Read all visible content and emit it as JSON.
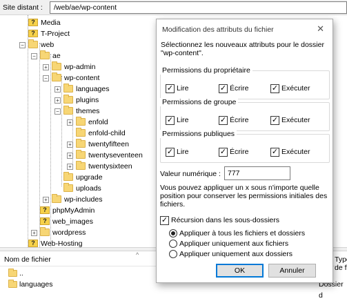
{
  "pathbar": {
    "label": "Site distant :",
    "value": "/web/ae/wp-content"
  },
  "tree": [
    {
      "label": "Media",
      "icon": "question-folder-icon",
      "expander": ""
    },
    {
      "label": "T-Project",
      "icon": "question-folder-icon",
      "expander": ""
    },
    {
      "label": "web",
      "icon": "folder-icon",
      "expander": "−"
    },
    {
      "label": "ae",
      "icon": "folder-icon",
      "expander": "−"
    },
    {
      "label": "wp-admin",
      "icon": "folder-icon",
      "expander": "+"
    },
    {
      "label": "wp-content",
      "icon": "folder-icon",
      "expander": "−"
    },
    {
      "label": "languages",
      "icon": "folder-icon",
      "expander": "+"
    },
    {
      "label": "plugins",
      "icon": "folder-icon",
      "expander": "+"
    },
    {
      "label": "themes",
      "icon": "folder-icon",
      "expander": "−"
    },
    {
      "label": "enfold",
      "icon": "folder-icon",
      "expander": "+"
    },
    {
      "label": "enfold-child",
      "icon": "folder-icon",
      "expander": ""
    },
    {
      "label": "twentyfifteen",
      "icon": "folder-icon",
      "expander": "+"
    },
    {
      "label": "twentyseventeen",
      "icon": "folder-icon",
      "expander": "+"
    },
    {
      "label": "twentysixteen",
      "icon": "folder-icon",
      "expander": "+"
    },
    {
      "label": "upgrade",
      "icon": "folder-icon",
      "expander": ""
    },
    {
      "label": "uploads",
      "icon": "folder-icon",
      "expander": ""
    },
    {
      "label": "wp-includes",
      "icon": "folder-icon",
      "expander": "+"
    },
    {
      "label": "phpMyAdmin",
      "icon": "question-folder-icon",
      "expander": ""
    },
    {
      "label": "web_images",
      "icon": "question-folder-icon",
      "expander": ""
    },
    {
      "label": "wordpress",
      "icon": "folder-icon",
      "expander": "+"
    },
    {
      "label": "Web-Hosting",
      "icon": "question-folder-icon",
      "expander": ""
    }
  ],
  "filelist": {
    "col_name": "Nom de fichier",
    "col_type": "Type de f",
    "rows": [
      {
        "name": "..",
        "type": ""
      },
      {
        "name": "languages",
        "type": "Dossier d"
      }
    ]
  },
  "dialog": {
    "title": "Modification des attributs du fichier",
    "close": "✕",
    "intro": "Sélectionnez les nouveaux attributs pour le dossier \"wp-content\".",
    "groups": [
      {
        "title": "Permissions du propriétaire",
        "read": "Lire",
        "write": "Écrire",
        "exec": "Exécuter"
      },
      {
        "title": "Permissions de groupe",
        "read": "Lire",
        "write": "Écrire",
        "exec": "Exécuter"
      },
      {
        "title": "Permissions publiques",
        "read": "Lire",
        "write": "Écrire",
        "exec": "Exécuter"
      }
    ],
    "check_mark": "✓",
    "numeric_label": "Valeur numérique :",
    "numeric_value": "777",
    "hint": "Vous pouvez appliquer un x sous n'importe quelle position pour conserver les permissions initiales des fichiers.",
    "recursion_label": "Récursion dans les sous-dossiers",
    "radios": [
      {
        "label": "Appliquer à tous les fichiers et dossiers",
        "selected": true
      },
      {
        "label": "Appliquer uniquement aux fichiers",
        "selected": false
      },
      {
        "label": "Appliquer uniquement aux dossiers",
        "selected": false
      }
    ],
    "ok": "OK",
    "cancel": "Annuler"
  }
}
